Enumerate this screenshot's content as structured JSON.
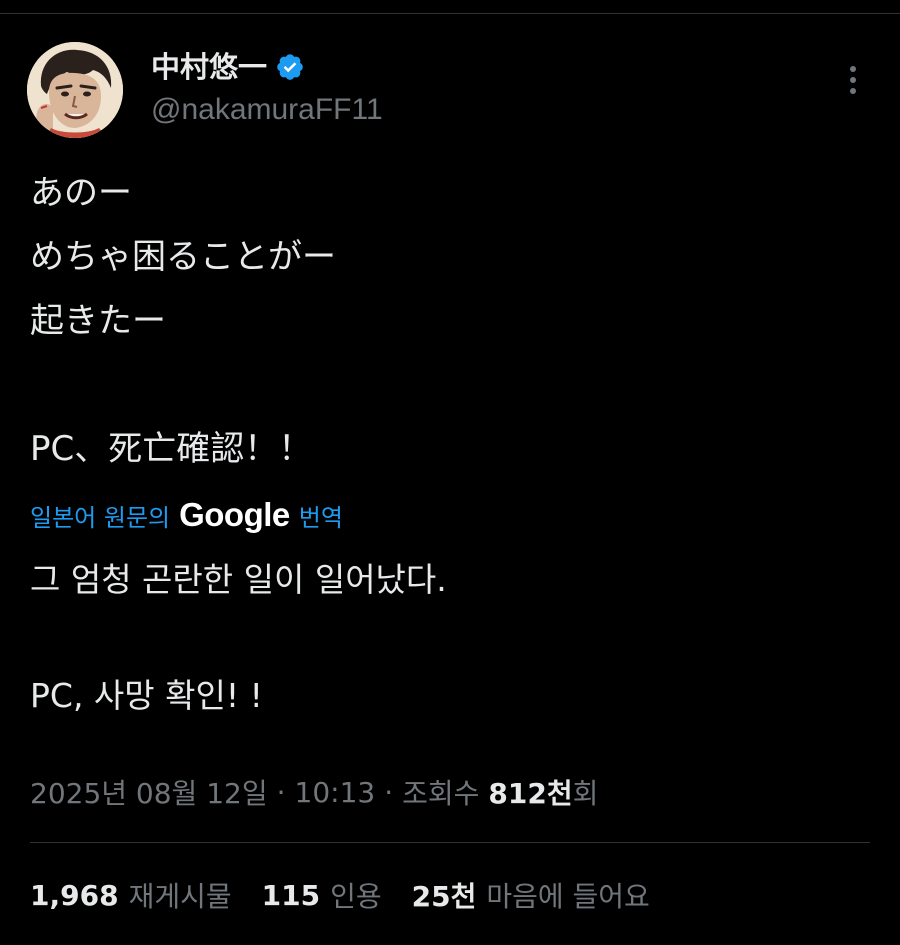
{
  "author": {
    "display_name": "中村悠一",
    "handle": "@nakamuraFF11",
    "verified_badge_icon": "verified-check-icon",
    "verified_color": "#1d9bf0"
  },
  "menu": {
    "more_icon": "more-vertical-icon"
  },
  "tweet": {
    "text": "あのー\nめちゃ困ることがー\n起きたー\n\nPC、死亡確認！！"
  },
  "translation": {
    "prefix": "일본어 원문의",
    "provider": "Google",
    "suffix": "번역",
    "link_color": "#1d9bf0",
    "text": "그 엄청 곤란한 일이 일어났다.\n\nPC, 사망 확인! !"
  },
  "meta": {
    "date": "2025년 08월 12일",
    "separator": "·",
    "time": "10:13",
    "views_prefix": "조회수",
    "views_count": "812천",
    "views_suffix": "회"
  },
  "stats": {
    "reposts_count": "1,968",
    "reposts_label": "재게시물",
    "quotes_count": "115",
    "quotes_label": "인용",
    "likes_count": "25천",
    "likes_label": "마음에 들어요"
  },
  "colors": {
    "background": "#000000",
    "text_primary": "#e7e9ea",
    "text_secondary": "#71767b",
    "divider": "#2f3336"
  }
}
